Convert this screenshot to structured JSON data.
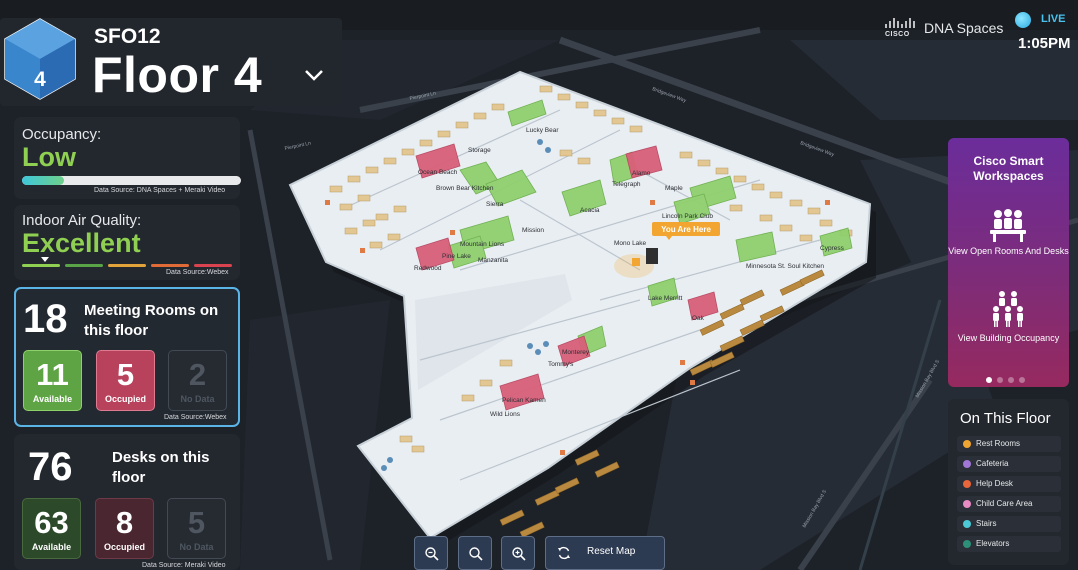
{
  "header": {
    "floor_badge": "4",
    "site_code": "SFO12",
    "floor_name": "Floor 4"
  },
  "occupancy": {
    "label": "Occupancy:",
    "value": "Low",
    "level_fraction": 0.19,
    "source": "Data Source: DNA Spaces + Meraki Video"
  },
  "air_quality": {
    "label": "Indoor Air Quality:",
    "value": "Excellent",
    "source": "Data Source:Webex",
    "scale_colors": [
      "#8fcf52",
      "#5aa448",
      "#e2a33b",
      "#e16b37",
      "#d8434f"
    ]
  },
  "meeting_rooms": {
    "count": "18",
    "title": "Meeting Rooms on this floor",
    "available": "11",
    "available_label": "Available",
    "occupied": "5",
    "occupied_label": "Occupied",
    "no_data": "2",
    "no_data_label": "No Data",
    "source": "Data Source:Webex"
  },
  "desks": {
    "count": "76",
    "title": "Desks on this floor",
    "available": "63",
    "available_label": "Available",
    "occupied": "8",
    "occupied_label": "Occupied",
    "no_data": "5",
    "no_data_label": "No Data",
    "source": "Data Source: Meraki Video"
  },
  "brand": {
    "company": "CISCO",
    "product": "DNA Spaces"
  },
  "status": {
    "live_label": "LIVE",
    "time": "1:05PM"
  },
  "smart_workspaces": {
    "title": "Cisco Smart Workspaces",
    "action_rooms": "View Open Rooms And Desks",
    "action_occupancy": "View Building Occupancy",
    "slides": 4,
    "active_slide": 1
  },
  "on_this_floor": {
    "title": "On This Floor",
    "items": [
      {
        "label": "Rest Rooms",
        "color": "#f0a531"
      },
      {
        "label": "Cafeteria",
        "color": "#a077d6"
      },
      {
        "label": "Help Desk",
        "color": "#e8663a"
      },
      {
        "label": "Child Care Area",
        "color": "#e88ac4"
      },
      {
        "label": "Stairs",
        "color": "#4cc9d6"
      },
      {
        "label": "Elevators",
        "color": "#2e8f78"
      }
    ]
  },
  "map": {
    "you_are_here": "You Are Here",
    "rooms": [
      "Lucky Bear",
      "Storage",
      "Ocean Beach",
      "Brown Bear Kitchen",
      "Sierra",
      "Acacia",
      "Mission",
      "Telegraph",
      "Alamo",
      "Lincoln Park Club",
      "Maple",
      "Cypress",
      "Mono Lake",
      "Mountain Lions",
      "Manzanita",
      "Pine Lake",
      "Redwood",
      "Minnesota St. Soul Kitchen",
      "Lake Merritt",
      "Oak",
      "Tommy's",
      "Monterey",
      "Pelican Kamen",
      "Wild Lions"
    ],
    "streets": [
      "Pierpoint Ln",
      "Bridgeview Way",
      "Mission Bay Blvd S"
    ]
  },
  "controls": {
    "zoom_out_icon": "zoom-out-icon",
    "zoom_reset_icon": "zoom-fit-icon",
    "zoom_in_icon": "zoom-in-icon",
    "reset_label": "Reset Map"
  }
}
